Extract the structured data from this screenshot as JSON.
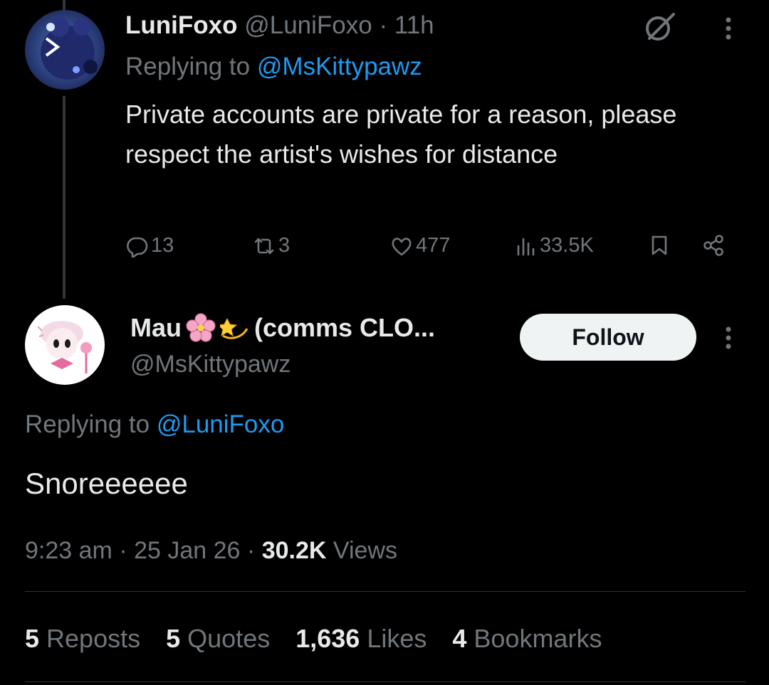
{
  "parent_tweet": {
    "display_name": "LuniFoxo",
    "handle": "@LuniFoxo",
    "separator": "·",
    "time": "11h",
    "replying_prefix": "Replying to ",
    "replying_mention": "@MsKittypawz",
    "text": "Private accounts are private for a reason, please respect the artist's wishes for distance",
    "replies": "13",
    "reposts": "3",
    "likes": "477",
    "views": "33.5K"
  },
  "main_tweet": {
    "display_name": "Mau",
    "name_suffix": "(comms CLO...",
    "handle": "@MsKittypawz",
    "follow_label": "Follow",
    "replying_prefix": "Replying to ",
    "replying_mention": "@LuniFoxo",
    "text": "Snoreeeeee",
    "time": "9:23 am",
    "sep1": "·",
    "date": "25 Jan 26",
    "sep2": "·",
    "views_count": "30.2K",
    "views_label": "Views"
  },
  "stats": {
    "reposts_num": "5",
    "reposts_label": "Reposts",
    "quotes_num": "5",
    "quotes_label": "Quotes",
    "likes_num": "1,636",
    "likes_label": "Likes",
    "bookmarks_num": "4",
    "bookmarks_label": "Bookmarks"
  },
  "icons": {
    "reply": "comment-icon",
    "repost": "repost-icon",
    "like": "heart-icon",
    "views": "analytics-icon",
    "bookmark": "bookmark-icon",
    "share": "share-icon",
    "grok": "grok-icon",
    "more": "more-vertical-icon",
    "emoji1": "cherry-blossom-emoji",
    "emoji2": "dizzy-star-emoji"
  },
  "colors": {
    "background": "#000000",
    "text_primary": "#e7e9ea",
    "text_secondary": "#71767b",
    "link": "#1d9bf0",
    "follow_bg": "#eff3f4"
  }
}
